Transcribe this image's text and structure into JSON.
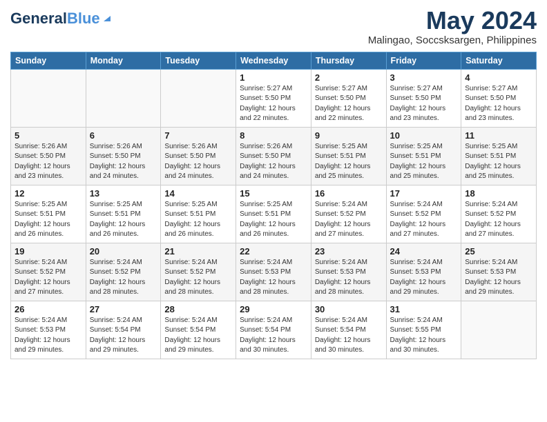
{
  "logo": {
    "name_part1": "General",
    "name_part2": "Blue"
  },
  "header": {
    "month": "May 2024",
    "location": "Malingao, Soccsksargen, Philippines"
  },
  "weekdays": [
    "Sunday",
    "Monday",
    "Tuesday",
    "Wednesday",
    "Thursday",
    "Friday",
    "Saturday"
  ],
  "weeks": [
    [
      {
        "num": "",
        "info": ""
      },
      {
        "num": "",
        "info": ""
      },
      {
        "num": "",
        "info": ""
      },
      {
        "num": "1",
        "info": "Sunrise: 5:27 AM\nSunset: 5:50 PM\nDaylight: 12 hours\nand 22 minutes."
      },
      {
        "num": "2",
        "info": "Sunrise: 5:27 AM\nSunset: 5:50 PM\nDaylight: 12 hours\nand 22 minutes."
      },
      {
        "num": "3",
        "info": "Sunrise: 5:27 AM\nSunset: 5:50 PM\nDaylight: 12 hours\nand 23 minutes."
      },
      {
        "num": "4",
        "info": "Sunrise: 5:27 AM\nSunset: 5:50 PM\nDaylight: 12 hours\nand 23 minutes."
      }
    ],
    [
      {
        "num": "5",
        "info": "Sunrise: 5:26 AM\nSunset: 5:50 PM\nDaylight: 12 hours\nand 23 minutes."
      },
      {
        "num": "6",
        "info": "Sunrise: 5:26 AM\nSunset: 5:50 PM\nDaylight: 12 hours\nand 24 minutes."
      },
      {
        "num": "7",
        "info": "Sunrise: 5:26 AM\nSunset: 5:50 PM\nDaylight: 12 hours\nand 24 minutes."
      },
      {
        "num": "8",
        "info": "Sunrise: 5:26 AM\nSunset: 5:50 PM\nDaylight: 12 hours\nand 24 minutes."
      },
      {
        "num": "9",
        "info": "Sunrise: 5:25 AM\nSunset: 5:51 PM\nDaylight: 12 hours\nand 25 minutes."
      },
      {
        "num": "10",
        "info": "Sunrise: 5:25 AM\nSunset: 5:51 PM\nDaylight: 12 hours\nand 25 minutes."
      },
      {
        "num": "11",
        "info": "Sunrise: 5:25 AM\nSunset: 5:51 PM\nDaylight: 12 hours\nand 25 minutes."
      }
    ],
    [
      {
        "num": "12",
        "info": "Sunrise: 5:25 AM\nSunset: 5:51 PM\nDaylight: 12 hours\nand 26 minutes."
      },
      {
        "num": "13",
        "info": "Sunrise: 5:25 AM\nSunset: 5:51 PM\nDaylight: 12 hours\nand 26 minutes."
      },
      {
        "num": "14",
        "info": "Sunrise: 5:25 AM\nSunset: 5:51 PM\nDaylight: 12 hours\nand 26 minutes."
      },
      {
        "num": "15",
        "info": "Sunrise: 5:25 AM\nSunset: 5:51 PM\nDaylight: 12 hours\nand 26 minutes."
      },
      {
        "num": "16",
        "info": "Sunrise: 5:24 AM\nSunset: 5:52 PM\nDaylight: 12 hours\nand 27 minutes."
      },
      {
        "num": "17",
        "info": "Sunrise: 5:24 AM\nSunset: 5:52 PM\nDaylight: 12 hours\nand 27 minutes."
      },
      {
        "num": "18",
        "info": "Sunrise: 5:24 AM\nSunset: 5:52 PM\nDaylight: 12 hours\nand 27 minutes."
      }
    ],
    [
      {
        "num": "19",
        "info": "Sunrise: 5:24 AM\nSunset: 5:52 PM\nDaylight: 12 hours\nand 27 minutes."
      },
      {
        "num": "20",
        "info": "Sunrise: 5:24 AM\nSunset: 5:52 PM\nDaylight: 12 hours\nand 28 minutes."
      },
      {
        "num": "21",
        "info": "Sunrise: 5:24 AM\nSunset: 5:52 PM\nDaylight: 12 hours\nand 28 minutes."
      },
      {
        "num": "22",
        "info": "Sunrise: 5:24 AM\nSunset: 5:53 PM\nDaylight: 12 hours\nand 28 minutes."
      },
      {
        "num": "23",
        "info": "Sunrise: 5:24 AM\nSunset: 5:53 PM\nDaylight: 12 hours\nand 28 minutes."
      },
      {
        "num": "24",
        "info": "Sunrise: 5:24 AM\nSunset: 5:53 PM\nDaylight: 12 hours\nand 29 minutes."
      },
      {
        "num": "25",
        "info": "Sunrise: 5:24 AM\nSunset: 5:53 PM\nDaylight: 12 hours\nand 29 minutes."
      }
    ],
    [
      {
        "num": "26",
        "info": "Sunrise: 5:24 AM\nSunset: 5:53 PM\nDaylight: 12 hours\nand 29 minutes."
      },
      {
        "num": "27",
        "info": "Sunrise: 5:24 AM\nSunset: 5:54 PM\nDaylight: 12 hours\nand 29 minutes."
      },
      {
        "num": "28",
        "info": "Sunrise: 5:24 AM\nSunset: 5:54 PM\nDaylight: 12 hours\nand 29 minutes."
      },
      {
        "num": "29",
        "info": "Sunrise: 5:24 AM\nSunset: 5:54 PM\nDaylight: 12 hours\nand 30 minutes."
      },
      {
        "num": "30",
        "info": "Sunrise: 5:24 AM\nSunset: 5:54 PM\nDaylight: 12 hours\nand 30 minutes."
      },
      {
        "num": "31",
        "info": "Sunrise: 5:24 AM\nSunset: 5:55 PM\nDaylight: 12 hours\nand 30 minutes."
      },
      {
        "num": "",
        "info": ""
      }
    ]
  ]
}
